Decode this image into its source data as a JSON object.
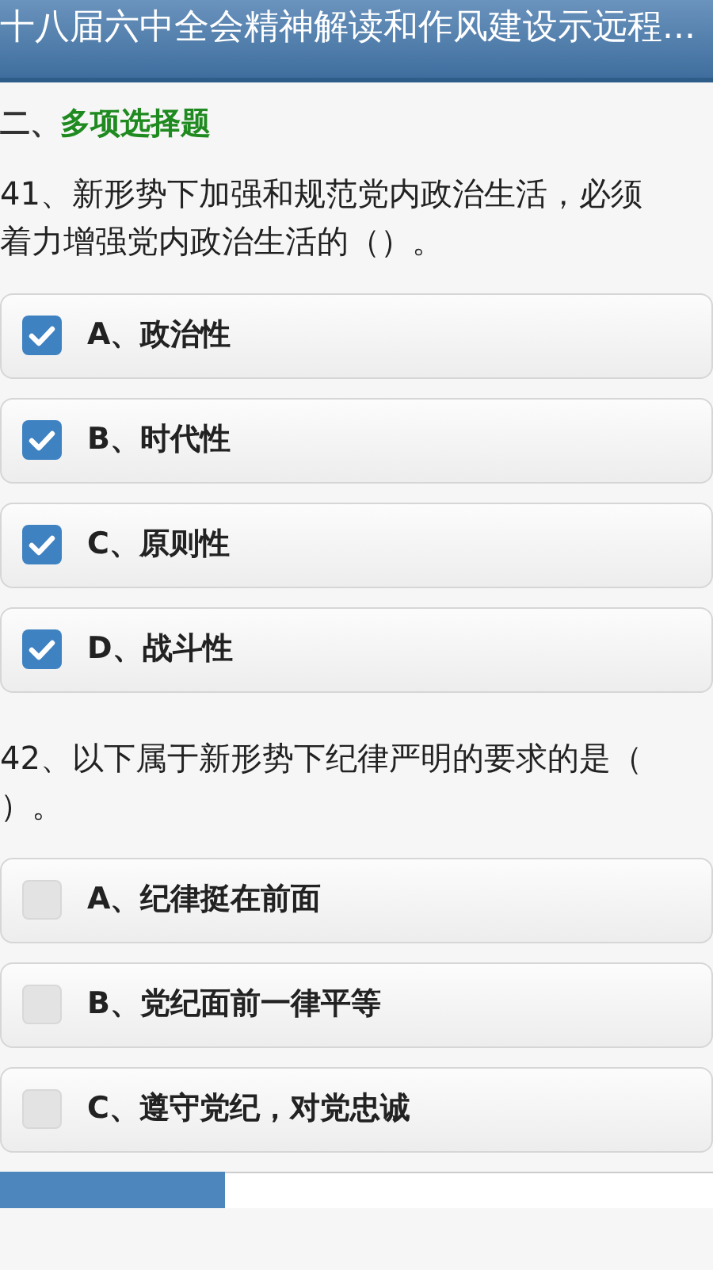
{
  "header": {
    "title": "十八届六中全会精神解读和作风建设示远程..."
  },
  "section": {
    "number": "二、",
    "title": "多项选择题"
  },
  "questions": [
    {
      "lines": [
        "41、新形势下加强和规范党内政治生活，必须",
        "着力增强党内政治生活的（）。"
      ],
      "options": [
        {
          "label": "A、政治性",
          "checked": true
        },
        {
          "label": "B、时代性",
          "checked": true
        },
        {
          "label": "C、原则性",
          "checked": true
        },
        {
          "label": "D、战斗性",
          "checked": true
        }
      ]
    },
    {
      "lines": [
        "42、以下属于新形势下纪律严明的要求的是（",
        "）。"
      ],
      "options": [
        {
          "label": "A、纪律挺在前面",
          "checked": false
        },
        {
          "label": "B、党纪面前一律平等",
          "checked": false
        },
        {
          "label": "C、遵守党纪，对党忠诚",
          "checked": false
        }
      ]
    }
  ]
}
